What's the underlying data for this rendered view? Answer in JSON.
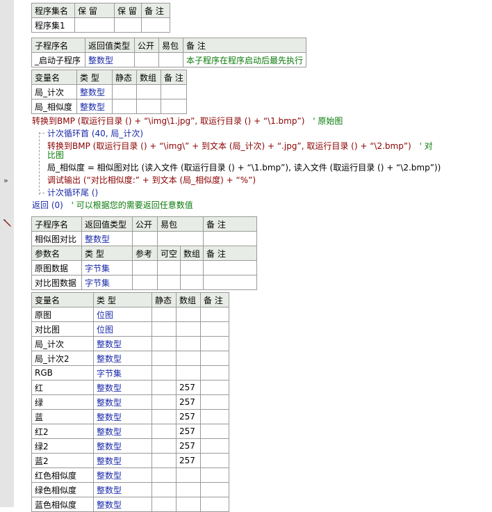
{
  "assembly": {
    "headers": [
      "程序集名",
      "保 留",
      "保 留",
      "备 注"
    ],
    "row": [
      "程序集1",
      "",
      "",
      ""
    ]
  },
  "sub_start": {
    "headers": [
      "子程序名",
      "返回值类型",
      "公开",
      "易包",
      "备 注"
    ],
    "row": [
      "_启动子程序",
      "整数型",
      "",
      "",
      "本子程序在程序启动后最先执行"
    ]
  },
  "vars_start": {
    "headers": [
      "变量名",
      "类 型",
      "静态",
      "数组",
      "备 注"
    ],
    "rows": [
      [
        "局_计次",
        "整数型",
        "",
        "",
        ""
      ],
      [
        "局_相似度",
        "整数型",
        "",
        "",
        ""
      ]
    ]
  },
  "code": {
    "line1": "转换到BMP (取运行目录 () + “\\img\\1.jpg”, 取运行目录 () + “\\1.bmp”)",
    "line1_comment": "' 原始图",
    "loop_head": "计次循环首 (40, 局_计次)",
    "line2a": "转换到BMP (取运行目录 () + “\\img\\” + 到文本 (局_计次) + “.jpg”, 取运行目录 () + “\\2.bmp”)",
    "line2_comment": "' 对",
    "line2b": "比图",
    "line3": "局_相似度 = 相似图对比 (读入文件 (取运行目录 () + “\\1.bmp”), 读入文件 (取运行目录 () + “\\2.bmp”))",
    "line4": "调试输出 (“对比相似度:” + 到文本 (局_相似度) + “%”)",
    "loop_tail": "计次循环尾 ()",
    "ret": "返回 (0)",
    "ret_comment": "' 可以根据您的需要返回任意数值"
  },
  "sub_compare": {
    "headers": [
      "子程序名",
      "返回值类型",
      "公开",
      "易包",
      "备 注"
    ],
    "row": [
      "相似图对比",
      "整数型",
      "",
      "",
      ""
    ],
    "param_headers": [
      "参数名",
      "类 型",
      "参考",
      "可空",
      "数组",
      "备 注"
    ],
    "params": [
      [
        "原图数据",
        "字节集",
        "",
        "",
        "",
        ""
      ],
      [
        "对比图数据",
        "字节集",
        "",
        "",
        "",
        ""
      ]
    ]
  },
  "vars_compare": {
    "headers": [
      "变量名",
      "类 型",
      "静态",
      "数组",
      "备 注"
    ],
    "rows": [
      [
        "原图",
        "位图",
        "",
        "",
        ""
      ],
      [
        "对比图",
        "位图",
        "",
        "",
        ""
      ],
      [
        "局_计次",
        "整数型",
        "",
        "",
        ""
      ],
      [
        "局_计次2",
        "整数型",
        "",
        "",
        ""
      ],
      [
        "RGB",
        "字节集",
        "",
        "",
        ""
      ],
      [
        "红",
        "整数型",
        "",
        "257",
        ""
      ],
      [
        "绿",
        "整数型",
        "",
        "257",
        ""
      ],
      [
        "蓝",
        "整数型",
        "",
        "257",
        ""
      ],
      [
        "红2",
        "整数型",
        "",
        "257",
        ""
      ],
      [
        "绿2",
        "整数型",
        "",
        "257",
        ""
      ],
      [
        "蓝2",
        "整数型",
        "",
        "257",
        ""
      ],
      [
        "红色相似度",
        "整数型",
        "",
        "",
        ""
      ],
      [
        "绿色相似度",
        "整数型",
        "",
        "",
        ""
      ],
      [
        "蓝色相似度",
        "整数型",
        "",
        "",
        ""
      ]
    ]
  },
  "gutter": {
    "arrow": "»",
    "icon": "pencil-icon"
  }
}
